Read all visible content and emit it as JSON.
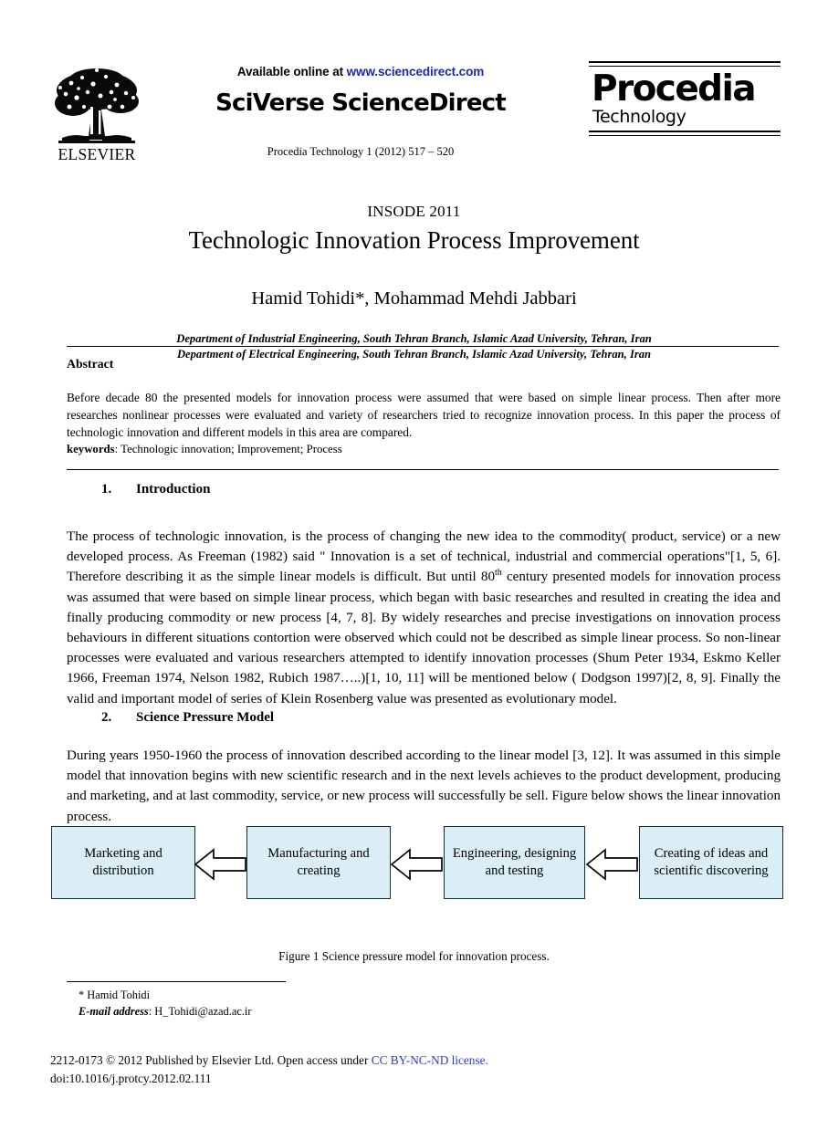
{
  "masthead": {
    "elsevier_logo_alt": "ELSEVIER",
    "elsevier_wordmark": "ELSEVIER",
    "available_prefix": "Available online at ",
    "available_url": "www.sciencedirect.com",
    "sciencedirect_wordmark": "SciVerse ScienceDirect",
    "journal_reference": "Procedia Technology 1 (2012) 517 – 520",
    "procedia_word": "Procedia",
    "procedia_sub": "Technology"
  },
  "title_block": {
    "conference": "INSODE 2011",
    "title": "Technologic Innovation Process Improvement",
    "authors": "Hamid Tohidi*, Mohammad Mehdi Jabbari",
    "affiliations": [
      "Department of Industrial Engineering, South Tehran Branch, Islamic Azad University, Tehran, Iran",
      "Department of Electrical Engineering, South Tehran Branch, Islamic Azad University, Tehran, Iran"
    ]
  },
  "abstract": {
    "heading": "Abstract",
    "text": "Before decade 80 the presented models for innovation process were assumed that were based on simple linear process. Then after more researches nonlinear processes were evaluated and variety of researchers tried to recognize innovation process. In this paper the process of technologic innovation and different models in this area are compared.",
    "keywords_label": "keywords",
    "keywords_value": ": Technologic innovation; Improvement; Process"
  },
  "sections": [
    {
      "number": "1.",
      "heading": "Introduction",
      "paragraph_part1": "The process of technologic innovation, is the process of changing the new idea to the commodity( product, service) or a new developed process. As Freeman (1982) said \" Innovation is a set of technical, industrial and commercial operations\"[1, 5, 6]. Therefore describing it as the simple linear models is difficult. But until 80",
      "superscript": "th",
      "paragraph_part2": " century presented models for innovation process was assumed that were based on simple linear process, which began with basic researches and resulted in creating the idea and finally producing commodity or new process [4, 7, 8].  By widely researches and precise investigations on innovation process behaviours in different situations contortion were observed which could not be described as simple linear process. So non-linear processes were evaluated and various researchers attempted to identify innovation processes (Shum Peter 1934, Eskmo Keller 1966, Freeman 1974, Nelson 1982, Rubich 1987…..)[1, 10, 11]  will be mentioned below ( Dodgson 1997)[2, 8, 9]. Finally the valid and important model of series of Klein Rosenberg value was presented as evolutionary model."
    },
    {
      "number": "2.",
      "heading": "Science Pressure Model",
      "paragraph": "During years 1950-1960 the process of innovation described according to the linear model [3, 12]. It was assumed in this simple model that innovation begins with new scientific research and in the next levels achieves to the product development, producing and marketing, and at last commodity, service, or new process will successfully be sell. Figure below shows the linear innovation process."
    }
  ],
  "figure": {
    "boxes": [
      "Marketing and distribution",
      "Manufacturing and creating",
      "Engineering, designing and testing",
      "Creating of ideas and scientific discovering"
    ],
    "arrow_direction": "left",
    "arrow_count": 3,
    "caption": "Figure 1 Science pressure model for innovation process.",
    "box_fill_color": "#dbeef5",
    "box_border_color": "#1a2e38"
  },
  "footnote": {
    "author_note": "* Hamid Tohidi",
    "email_label": "E-mail address",
    "email_value": ": H_Tohidi@azad.ac.ir"
  },
  "footer": {
    "issn_line_prefix": "2212-0173 © 2012 Published by Elsevier Ltd.  Open access under ",
    "license_text": "CC BY-NC-ND license.",
    "doi": "doi:10.1016/j.protcy.2012.02.111"
  }
}
